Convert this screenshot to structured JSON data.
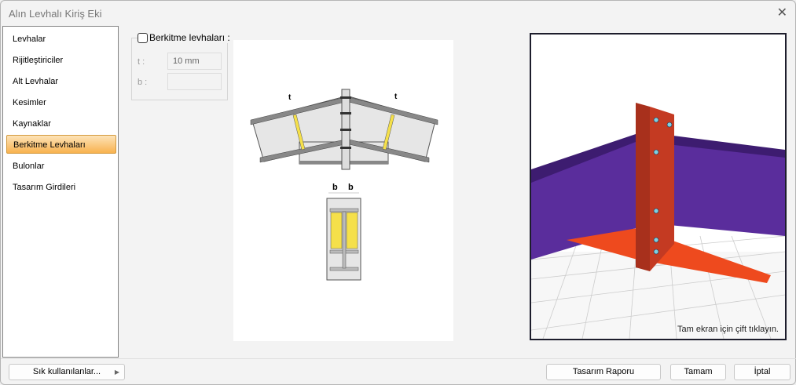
{
  "window": {
    "title": "Alın Levhalı Kiriş Eki",
    "close": "✕"
  },
  "nav": {
    "items": [
      "Levhalar",
      "Rijitleştiriciler",
      "Alt Levhalar",
      "Kesimler",
      "Kaynaklar",
      "Berkitme Levhaları",
      "Bulonlar",
      "Tasarım Girdileri"
    ],
    "active": 5
  },
  "form": {
    "checkbox_label": "Berkitme levhaları :",
    "checked": false,
    "t_label": "t :",
    "t_value": "10 mm",
    "b_label": "b :",
    "b_value": ""
  },
  "diagram": {
    "t": "t",
    "b": "b"
  },
  "view": {
    "hint": "Tam ekran için çift tıklayın."
  },
  "footer": {
    "favorites": "Sık kullanılanlar...",
    "report": "Tasarım Raporu",
    "ok": "Tamam",
    "cancel": "İptal"
  },
  "colors": {
    "active": "#f8b24f",
    "beam": "#5a2d9c",
    "plate": "#ee4a1e",
    "endplate": "#a8301c",
    "stiffener": "#f5e04a"
  }
}
